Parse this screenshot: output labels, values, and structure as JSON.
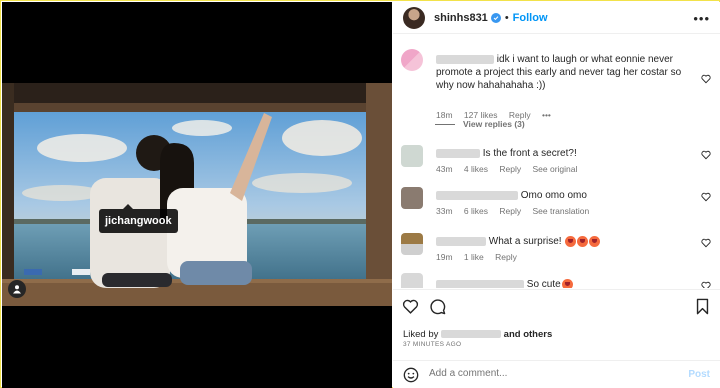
{
  "post": {
    "photo_tag": "jichangwook"
  },
  "header": {
    "username": "shinhs831",
    "separator": "•",
    "follow": "Follow",
    "more": "•••"
  },
  "comments": [
    {
      "text": "idk i want to laugh or what eonnie never promote a project this early and never tag her costar so why now hahahahaha :))",
      "time": "18m",
      "likes": "127 likes",
      "reply": "Reply",
      "more": "•••",
      "view_replies": "View replies (3)",
      "avatar_color": "#f0a6c8"
    },
    {
      "text": "Is the front a secret?!",
      "time": "43m",
      "likes": "4 likes",
      "reply": "Reply",
      "see": "See original",
      "avatar_color": "#cfd8d2"
    },
    {
      "text": "Omo omo omo",
      "time": "33m",
      "likes": "6 likes",
      "reply": "Reply",
      "see": "See translation",
      "avatar_color": "#8a7b70"
    },
    {
      "text": "What a surprise!",
      "time": "19m",
      "likes": "1 like",
      "reply": "Reply",
      "avatar_color": "#9c7a45"
    },
    {
      "text": "So cute",
      "avatar_color": "#d8d8d8"
    }
  ],
  "likes": {
    "prefix": "Liked by",
    "suffix": "and others",
    "ago": "37 MINUTES AGO"
  },
  "add_comment": {
    "placeholder": "Add a comment...",
    "post": "Post"
  },
  "icons": {
    "verified": "verified-badge-icon",
    "heart": "heart-icon",
    "comment": "comment-icon",
    "bookmark": "bookmark-icon",
    "emoji": "emoji-icon",
    "user_tag": "user-tag-icon"
  },
  "colors": {
    "accent": "#0095f6",
    "post_disabled": "#b3dbff"
  }
}
